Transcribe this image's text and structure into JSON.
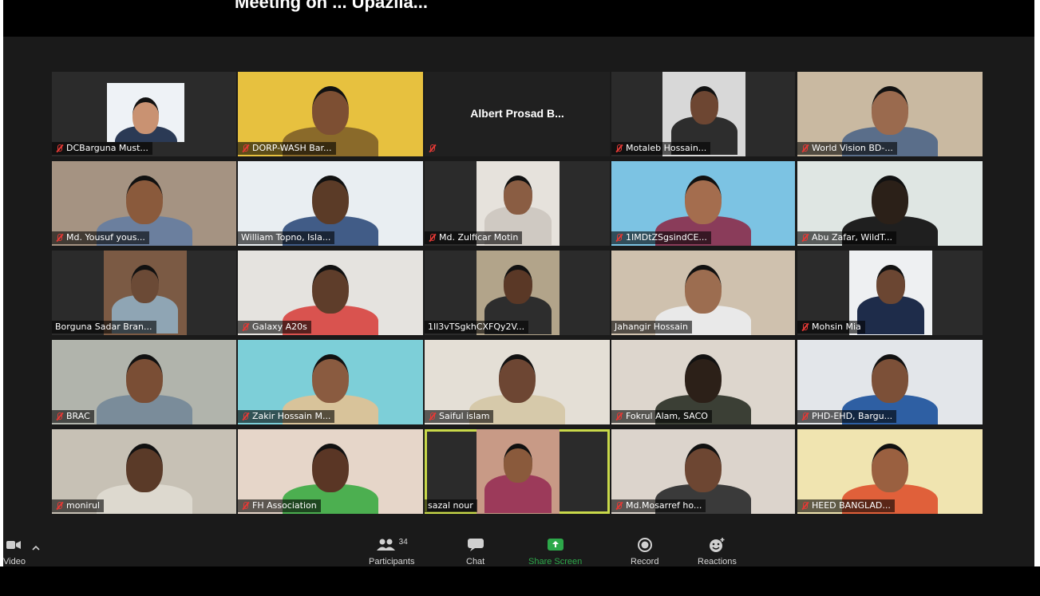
{
  "title": "Meeting on ... Upazila...",
  "participants": [
    {
      "name": "DCBarguna Must...",
      "muted": true,
      "bg": "#2b2b2b",
      "portrait": true,
      "shirt": "#2b3a55",
      "skin": "#c99272"
    },
    {
      "name": "DORP-WASH Bar...",
      "muted": true,
      "bg": "#caa03a",
      "wall": "#e7c13f",
      "shirt": "#8a6a2a",
      "skin": "#7d4f33"
    },
    {
      "name": "Albert Prosad B...",
      "muted": true,
      "bg": "#202020",
      "blank": true
    },
    {
      "name": "Motaleb Hossain...",
      "muted": true,
      "bg": "#2b2b2b",
      "wall": "#d8d8d8",
      "shirt": "#2d2d2d",
      "skin": "#6d4632"
    },
    {
      "name": "World Vision BD-...",
      "muted": true,
      "bg": "#b7a898",
      "wall": "#c9b9a1",
      "shirt": "#5a6e8a",
      "skin": "#9a6a4e"
    },
    {
      "name": "Md. Yousuf yous...",
      "muted": true,
      "bg": "#8d7d6e",
      "wall": "#a59382",
      "shirt": "#6b7f9e",
      "skin": "#8a5a3c"
    },
    {
      "name": "William Topno, Isla...",
      "muted": false,
      "bg": "#bcc7d1",
      "wall": "#e9eef2",
      "shirt": "#415c87",
      "skin": "#5b3b27"
    },
    {
      "name": "Md. Zulficar Motin",
      "muted": true,
      "bg": "#2b2b2b",
      "wall": "#e6e2dc",
      "shirt": "#cfc9c2",
      "skin": "#8a5d43"
    },
    {
      "name": "1IMDtZSgsindCE...",
      "muted": true,
      "bg": "#5aa4c8",
      "wall": "#7cc3e3",
      "shirt": "#8a3c5a",
      "skin": "#a46d4e"
    },
    {
      "name": "Abu Zafar, WildT...",
      "muted": true,
      "bg": "#b8c0bd",
      "wall": "#dfe6e3",
      "shirt": "#1f1f1f",
      "skin": "#2b2018"
    },
    {
      "name": "Borguna Sadar Bran...",
      "muted": false,
      "bg": "#2b2b2b",
      "wall": "#7b5a44",
      "shirt": "#8fa5b4",
      "skin": "#6b4a36"
    },
    {
      "name": "Galaxy A20s",
      "muted": true,
      "bg": "#d2cfc9",
      "wall": "#e5e3df",
      "shirt": "#d9534f",
      "skin": "#5e3d2a"
    },
    {
      "name": "1Il3vTSgkhCXFQy2V...",
      "muted": false,
      "bg": "#2b2b2b",
      "wall": "#b2a48a",
      "shirt": "#2d2d2d",
      "skin": "#5a3826"
    },
    {
      "name": "Jahangir Hossain",
      "muted": false,
      "bg": "#a39585",
      "wall": "#cfc1ae",
      "shirt": "#e9e9e9",
      "skin": "#9c6d50"
    },
    {
      "name": "Mohsin Mia",
      "muted": true,
      "bg": "#2b2b2b",
      "wall": "#eef0f2",
      "shirt": "#1e2c4a",
      "skin": "#6b4632"
    },
    {
      "name": "BRAC",
      "muted": true,
      "bg": "#8c8f88",
      "wall": "#b1b4ac",
      "shirt": "#7a8c9a",
      "skin": "#7a4e35"
    },
    {
      "name": "Zakir Hossain M...",
      "muted": true,
      "bg": "#58b8c6",
      "wall": "#7dcfd8",
      "shirt": "#d8c39a",
      "skin": "#8a5b40"
    },
    {
      "name": "Saiful islam",
      "muted": true,
      "bg": "#c6c1b8",
      "wall": "#e4dfd6",
      "shirt": "#d6c9aa",
      "skin": "#6d4633"
    },
    {
      "name": "Fokrul Alam, SACO",
      "muted": true,
      "bg": "#6a6560",
      "wall": "#ddd6cd",
      "shirt": "#3b3f35",
      "skin": "#2c2018"
    },
    {
      "name": "PHD-EHD, Bargu...",
      "muted": true,
      "bg": "#5a86c2",
      "wall": "#e3e6ea",
      "shirt": "#2e5fa3",
      "skin": "#7c5038"
    },
    {
      "name": "monirul",
      "muted": true,
      "bg": "#8fa08b",
      "wall": "#c7c1b5",
      "shirt": "#ddd9cf",
      "skin": "#5a3a28"
    },
    {
      "name": "FH Association",
      "muted": true,
      "bg": "#c9504c",
      "wall": "#e6d6c9",
      "shirt": "#4caf50",
      "skin": "#5a3625"
    },
    {
      "name": "sazal nour",
      "muted": false,
      "bg": "#2b2b2b",
      "wall": "#c89a86",
      "shirt": "#9c3a5a",
      "skin": "#8a5a3c",
      "active": true
    },
    {
      "name": "Md.Mosarref ho...",
      "muted": true,
      "bg": "#b0a8a0",
      "wall": "#dcd4cc",
      "shirt": "#3a3a3a",
      "skin": "#6d4632"
    },
    {
      "name": "HEED BANGLAD...",
      "muted": true,
      "bg": "#d9c87a",
      "wall": "#f0e4b0",
      "shirt": "#e0603a",
      "skin": "#9a6040"
    }
  ],
  "toolbar": {
    "video_label": "Video",
    "participants_count": "34",
    "participants_label": "Participants",
    "chat_label": "Chat",
    "share_label": "Share Screen",
    "record_label": "Record",
    "reactions_label": "Reactions",
    "share_color": "#2da84a"
  }
}
